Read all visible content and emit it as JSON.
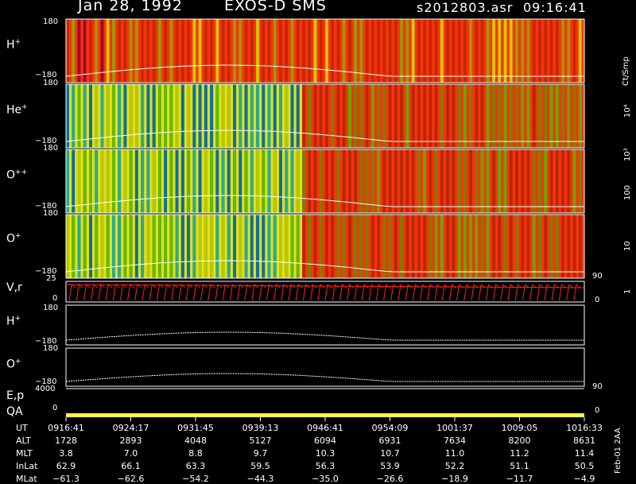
{
  "header": {
    "date": "Jan 28, 1992",
    "instrument": "EXOS-D SMS",
    "file": "s2012803.asr",
    "time": "09:16:41"
  },
  "colorbar": {
    "unit": "Ct/Smp",
    "labels": [
      "10⁴",
      "10³",
      "100",
      "10",
      "1"
    ],
    "colors": [
      "#ffffff",
      "#c00000",
      "#a00020",
      "#e00000",
      "#ff2000",
      "#808000",
      "#a08000",
      "#c0a000",
      "#e0d000",
      "#ffff00",
      "#d8e000",
      "#a0d000",
      "#60c000",
      "#20a000",
      "#00c0c0",
      "#0080c0",
      "#0050a0",
      "#002080"
    ]
  },
  "panels": [
    {
      "label": "H",
      "sup": "+",
      "ymax": "180",
      "ymin": "−180"
    },
    {
      "label": "He",
      "sup": "+",
      "ymax": "180",
      "ymin": "−180"
    },
    {
      "label": "O",
      "sup": "++",
      "ymax": "180",
      "ymin": "−180"
    },
    {
      "label": "O",
      "sup": "+",
      "ymax": "180",
      "ymin": "−180"
    }
  ],
  "vr_panel": {
    "label": "V,r",
    "ymax": "25",
    "ymin": "0",
    "rmax": "90",
    "rmin": "0"
  },
  "line_panels": [
    {
      "label": "H",
      "sup": "+",
      "ymax": "180",
      "ymin": "−180"
    },
    {
      "label": "O",
      "sup": "+",
      "ymax": "180",
      "ymin": "−180"
    }
  ],
  "ep_panel": {
    "label": "E,p",
    "ymax": "4000",
    "rmax": "90"
  },
  "qa_panel": {
    "label": "QA",
    "ymin": "0",
    "rmin": "0",
    "bar_color": "#ffff40"
  },
  "chart_data": {
    "type": "heatmap",
    "x_label": "UT",
    "ut": [
      "0916:41",
      "0924:17",
      "0931:45",
      "0939:13",
      "0946:41",
      "0954:09",
      "1001:37",
      "1009:05",
      "1016:33"
    ],
    "table": {
      "rows": [
        {
          "name": "UT",
          "values": [
            "0916:41",
            "0924:17",
            "0931:45",
            "0939:13",
            "0946:41",
            "0954:09",
            "1001:37",
            "1009:05",
            "1016:33"
          ]
        },
        {
          "name": "ALT",
          "values": [
            "1728",
            "2893",
            "4048",
            "5127",
            "6094",
            "6931",
            "7634",
            "8200",
            "8631"
          ]
        },
        {
          "name": "MLT",
          "values": [
            "3.8",
            "7.0",
            "8.8",
            "9.7",
            "10.3",
            "10.7",
            "11.0",
            "11.2",
            "11.4"
          ]
        },
        {
          "name": "InLat",
          "values": [
            "62.9",
            "66.1",
            "63.3",
            "59.5",
            "56.3",
            "53.9",
            "52.2",
            "51.1",
            "50.5"
          ]
        },
        {
          "name": "MLat",
          "values": [
            "−61.3",
            "−62.6",
            "−54.2",
            "−44.3",
            "−35.0",
            "−26.6",
            "−18.9",
            "−11.7",
            "−4.9"
          ]
        }
      ]
    },
    "pitch_angle_range": [
      -180,
      180
    ],
    "count_scale": "log",
    "count_range": [
      1,
      10000
    ]
  },
  "stamp": "Feb-01 2AA"
}
